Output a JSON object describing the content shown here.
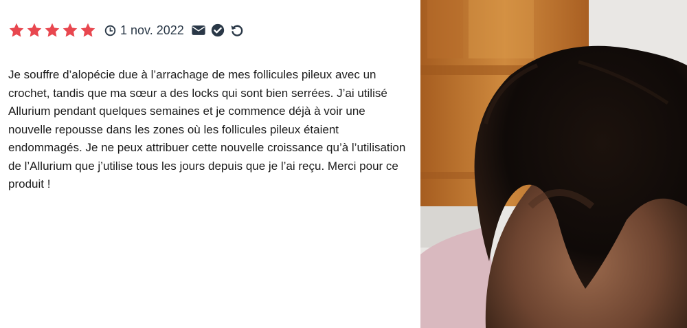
{
  "review": {
    "rating": 5,
    "rating_max": 5,
    "date": "1 nov. 2022",
    "text": "Je souffre d’alopécie due à l’arrachage de mes follicules pileux avec un crochet, tandis que ma sœur a des locks qui sont bien serrées. J’ai utilisé Allurium pendant quelques semaines et je commence déjà à voir une nouvelle repousse dans les zones où les follicules pileux étaient endommagés. Je ne peux attribuer cette nouvelle croissance qu’à l’utilisation de l’Allurium que j’utilise tous les jours depuis que je l’ai reçu. Merci pour ce produit !"
  },
  "icons": {
    "star": "star-icon",
    "clock": "clock-icon",
    "envelope": "envelope-icon",
    "verified": "check-circle-icon",
    "refresh": "refresh-icon"
  },
  "colors": {
    "star": "#e8474f",
    "icon_dark": "#2a3847",
    "text": "#1c1c1c"
  }
}
